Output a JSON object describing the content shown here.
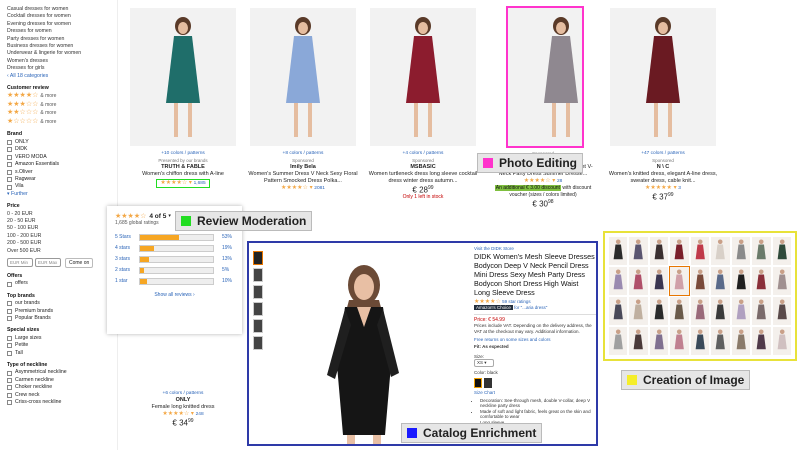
{
  "sidebar": {
    "categories": [
      "Casual dresses for women",
      "Cocktail dresses for women",
      "Evening dresses for women",
      "Dresses for women",
      "Party dresses for women",
      "Business dresses for women",
      "Underwear & lingerie for women",
      "Women's dresses",
      "Dresses for girls"
    ],
    "all_categories": "‹ All 18 categories",
    "customer_review": "Customer review",
    "review_rows": [
      {
        "stars": "★★★★☆",
        "more": "& more"
      },
      {
        "stars": "★★★☆☆",
        "more": "& more"
      },
      {
        "stars": "★★☆☆☆",
        "more": "& more"
      },
      {
        "stars": "★☆☆☆☆",
        "more": "& more"
      }
    ],
    "brand_head": "Brand",
    "brands": [
      "ONLY",
      "DIDK",
      "VERO MODA",
      "Amazon Essentials",
      "s.Oliver",
      "Ragwear",
      "Vila"
    ],
    "further": "▾ Further",
    "price_head": "Price",
    "prices": [
      "0 - 20 EUR",
      "20 - 50 EUR",
      "50 - 100 EUR",
      "100 - 200 EUR",
      "200 - 500 EUR",
      "Over 500 EUR"
    ],
    "min_placeholder": "EUR Min",
    "max_placeholder": "EUR Max",
    "go_label": "Come on",
    "offers_head": "Offers",
    "offers": [
      "offers"
    ],
    "top_brands_head": "Top brands",
    "top_brands": [
      "our brands",
      "Premium brands",
      "Popular Brands"
    ],
    "special_head": "Special sizes",
    "special": [
      "Large sizes",
      "Petite",
      "Tall"
    ],
    "neck_head": "Type of neckline",
    "necklines": [
      "Asymmetrical neckline",
      "Carmen neckline",
      "Choker neckline",
      "Crew neck",
      "Criss-cross neckline"
    ]
  },
  "products": [
    {
      "colors": "+10 colors / patterns",
      "spon": "Presented by our brands",
      "brand": "TRUTH & FABLE",
      "title": "Women's chiffon dress with A-line",
      "stars": "★★★★☆",
      "count": "1,685",
      "price": "",
      "cents": "",
      "extra": ""
    },
    {
      "colors": "+8 colors / patterns",
      "spon": "Sponsored",
      "brand": "Imily Bela",
      "title": "Women's Summer Dress V Neck Sexy Floral Pattern Smocked Dress Polka...",
      "stars": "★★★★☆",
      "count": "2081",
      "price": "",
      "cents": "",
      "extra": ""
    },
    {
      "colors": "+4 colors / patterns",
      "spon": "Sponsored",
      "brand": "MSBASIC",
      "title": "Women turtleneck dress long sleeve cocktail dress winter dress autumn...",
      "stars": "",
      "count": "",
      "price": "28",
      "cents": "99",
      "extra": "Only 1 left in stock"
    },
    {
      "colors": "",
      "spon": "Sponsored",
      "brand": "Ajpguot",
      "title": "Women's Boho Long Dresses Elegant V-Neck Party Dress Summer Dresse...",
      "stars": "★★★★☆",
      "count": "28",
      "price": "30",
      "cents": "98",
      "extra": "",
      "coupon": "An additional € 3.00 discount",
      "coupon_tail": "with discount voucher (sizes / colors limited)"
    },
    {
      "colors": "+47 colors / patterns",
      "spon": "Sponsored",
      "brand": "N \\ C",
      "title": "Women's knitted dress, elegant A-line dress, sweater dress, cable knit...",
      "stars": "★★★★★",
      "count": "3",
      "price": "37",
      "cents": "99",
      "extra": ""
    },
    {
      "colors": "+6 colors / patterns",
      "spon": "",
      "brand": "ONLY",
      "title": "Female long knitted dress",
      "stars": "★★★★☆",
      "count": "248",
      "price": "34",
      "cents": "99",
      "extra": ""
    }
  ],
  "labels": {
    "photo": "Photo Editing",
    "review": "Review Moderation",
    "catalog": "Catalog Enrichment",
    "creation": "Creation of Image"
  },
  "popup": {
    "stars": "★★★★☆",
    "rating": "4 of 5",
    "global": "1,685 global ratings",
    "rows": [
      {
        "label": "5 Stars",
        "pct": "53%",
        "v": 0.53
      },
      {
        "label": "4 stars",
        "pct": "19%",
        "v": 0.19
      },
      {
        "label": "3 stars",
        "pct": "13%",
        "v": 0.13
      },
      {
        "label": "2 stars",
        "pct": "5%",
        "v": 0.05
      },
      {
        "label": "1 star",
        "pct": "10%",
        "v": 0.1
      }
    ],
    "show_all": "Show all reviews ›"
  },
  "detail": {
    "visit": "Visit the DIDK Store",
    "title": "DIDK Women's Mesh Sleeve Dresses Bodycon Deep V Neck Pencil Dress Mini Dress Sexy Mesh Party Dress Bodycon Short Dress High Waist Long Sleeve Dress",
    "stars": "★★★★☆",
    "ratings": "59 star ratings",
    "choice": "Amazon's Choice",
    "choice_for": "for \"...aria dress\"",
    "price": "Price: € 54.99",
    "vat": "Prices include VAT. Depending on the delivery address, the VAT at the checkout may vary. Additional information.",
    "free_ret": "Free returns on some sizes and colors",
    "fit": "Fit: As expected",
    "size": "Size:",
    "size_val": "XS",
    "color": "Color: black",
    "size_chart": "Size Chart",
    "bullets": [
      "Decoration: See-through mesh, double V-collar, deep V neckline party dress",
      "Made of soft and light fabric, feels great on the skin and comfortable to wear",
      "Long sleeve",
      "Mini dress",
      "Pencil dress, slim fit"
    ]
  },
  "colors": {
    "pink": "#ff33cc",
    "green": "#22dd22",
    "blue": "#2e3aa8",
    "yellow": "#e8e23a",
    "star": "#f3a847",
    "link": "#2a64b8",
    "bar": "#f6a623"
  }
}
